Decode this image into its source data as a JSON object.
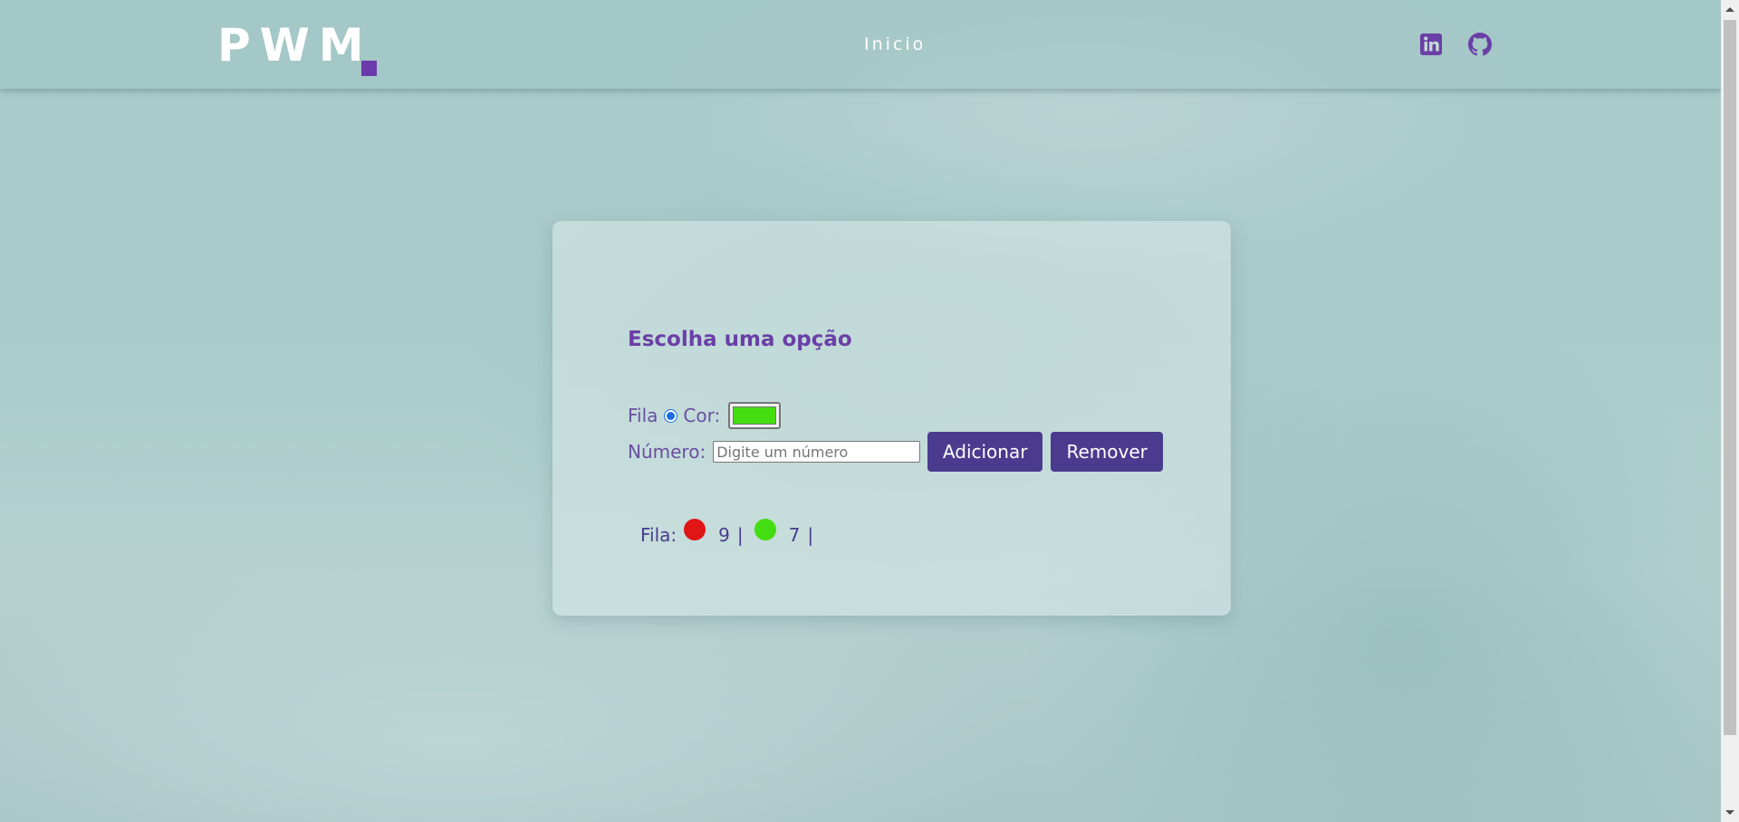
{
  "header": {
    "logo_text": "PWM",
    "nav_inicio": "Inicio",
    "icons": [
      "linkedin-icon",
      "github-icon"
    ]
  },
  "card": {
    "title": "Escolha uma opção",
    "fila_label": "Fila",
    "cor_label": "Cor:",
    "selected_color": "#44dd11",
    "numero_label": "Número:",
    "numero_placeholder": "Digite um número",
    "numero_value": "",
    "add_button": "Adicionar",
    "remove_button": "Remover"
  },
  "queue": {
    "label": "Fila:",
    "items": [
      {
        "color": "#e01616",
        "value": "9",
        "sep": "|"
      },
      {
        "color": "#44dd11",
        "value": "7",
        "sep": "|"
      }
    ]
  },
  "colors": {
    "accent": "#6a3fa6",
    "button_bg": "#4a3b8f",
    "logo_dot": "#6c3bab"
  }
}
